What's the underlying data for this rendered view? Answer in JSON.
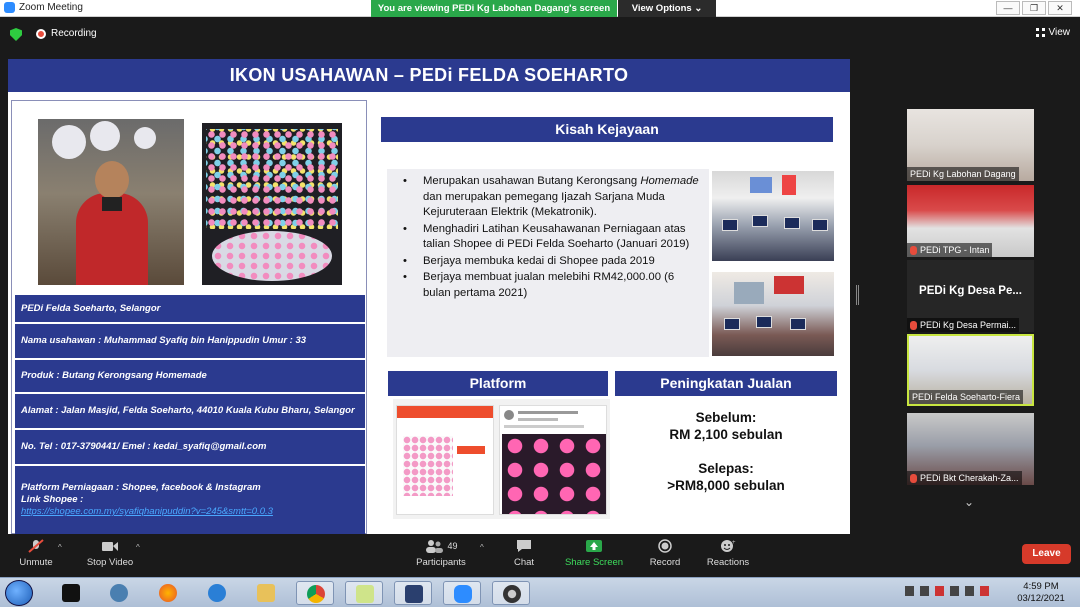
{
  "window": {
    "title": "Zoom Meeting",
    "banner": "You are viewing PEDi Kg Labohan Dagang's screen",
    "view_options": "View Options ⌄",
    "controls": [
      "—",
      "❐",
      "✕"
    ]
  },
  "meeting": {
    "recording": "Recording",
    "view": "View"
  },
  "slide": {
    "title": "IKON USAHAWAN – PEDi FELDA SOEHARTO",
    "info": {
      "location": "PEDi Felda Soeharto, Selangor",
      "name": "Nama usahawan : Muhammad Syafiq bin Hanippudin  Umur : 33",
      "product": "Produk : Butang Kerongsang Homemade",
      "address": "Alamat : Jalan Masjid, Felda Soeharto, 44010 Kuala Kubu Bharu, Selangor",
      "contact": "No. Tel :  017-3790441/ Emel : kedai_syafiq@gmail.com",
      "platform_line": "Platform Perniagaan : Shopee, facebook & Instagram",
      "shopee_label": "Link Shopee :",
      "shopee_link": "https://shopee.com.my/syafiqhanipuddin?v=245&smtt=0.0.3"
    },
    "kisah": {
      "heading": "Kisah Kejayaan",
      "bullets": [
        {
          "a": "Merupakan usahawan Butang Kerongsang ",
          "em": "Homemade",
          "b": " dan merupakan pemegang Ijazah Sarjana Muda Kejuruteraan Elektrik (Mekatronik)."
        },
        {
          "a": "Menghadiri Latihan Keusahawanan Perniagaan atas talian Shopee di PEDi Felda Soeharto (Januari 2019)",
          "em": "",
          "b": ""
        },
        {
          "a": "Berjaya membuka kedai di Shopee pada 2019",
          "em": "",
          "b": ""
        },
        {
          "a": "Berjaya membuat jualan melebihi RM42,000.00 (6 bulan pertama 2021)",
          "em": "",
          "b": ""
        }
      ]
    },
    "platform": {
      "heading": "Platform"
    },
    "jualan": {
      "heading": "Peningkatan Jualan",
      "before_label": "Sebelum:",
      "before_value": "RM 2,100 sebulan",
      "after_label": "Selepas:",
      "after_value": ">RM8,000 sebulan"
    }
  },
  "participants_strip": [
    {
      "name": "PEDi Kg Labohan Dagang",
      "muted": false
    },
    {
      "name": "PEDi TPG - Intan",
      "muted": true
    },
    {
      "name": "PEDi Kg Desa Permai...",
      "muted": true,
      "center": "PEDi Kg Desa Pe..."
    },
    {
      "name": "PEDi Felda Soeharto-Fiera",
      "muted": false,
      "active": true
    },
    {
      "name": "PEDi Bkt Cherakah-Za...",
      "muted": true
    }
  ],
  "toolbar": {
    "unmute": "Unmute",
    "stop_video": "Stop Video",
    "participants": "Participants",
    "participants_count": "49",
    "chat": "Chat",
    "share": "Share Screen",
    "record": "Record",
    "reactions": "Reactions",
    "leave": "Leave"
  },
  "taskbar": {
    "time": "4:59 PM",
    "date": "03/12/2021"
  },
  "colors": {
    "slide_blue": "#2b3a8f",
    "share_green": "#2aa84a",
    "leave_red": "#d63a2a"
  }
}
